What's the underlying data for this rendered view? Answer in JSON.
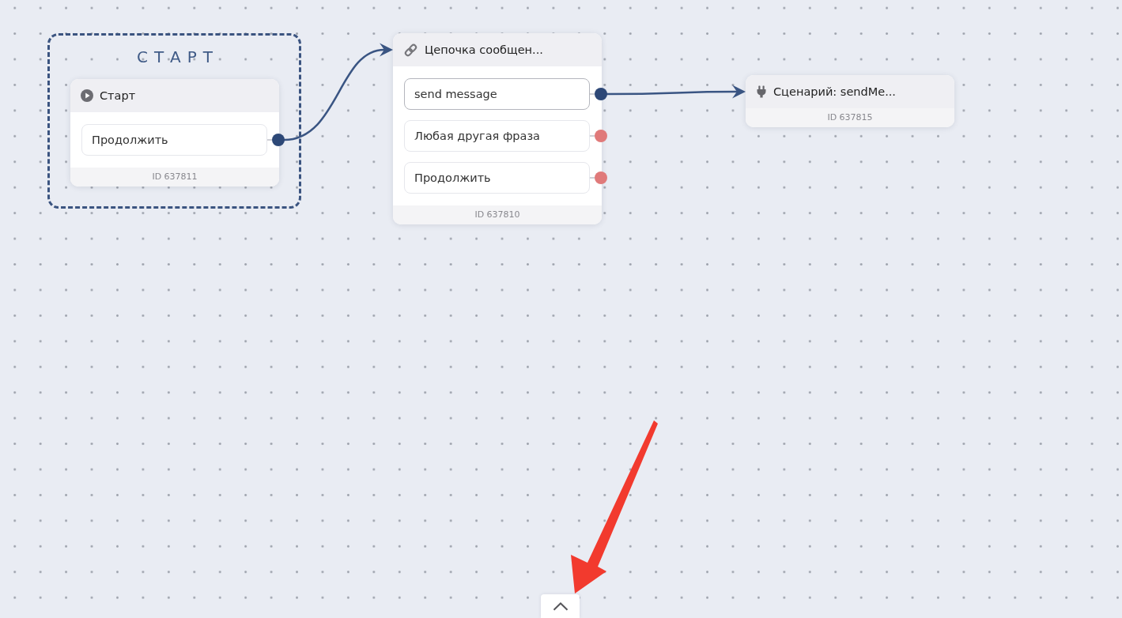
{
  "canvas": {
    "groups": [
      {
        "title": "СТАРТ",
        "nodes": [
          {
            "kind": "start",
            "title": "Старт",
            "outputs": [
              {
                "label": "Продолжить",
                "selected": false,
                "connected": true
              }
            ],
            "id_label": "ID 637811"
          }
        ]
      }
    ],
    "nodes": [
      {
        "kind": "chain",
        "title": "Цепочка сообщен...",
        "outputs": [
          {
            "label": "send message",
            "selected": true,
            "connected": true
          },
          {
            "label": "Любая другая фраза",
            "selected": false,
            "connected": false
          },
          {
            "label": "Продолжить",
            "selected": false,
            "connected": false
          }
        ],
        "id_label": "ID 637810"
      },
      {
        "kind": "scenario",
        "title": "Сценарий: sendMe...",
        "id_label": "ID 637815"
      }
    ]
  },
  "bottom_panel": {
    "expanded": false
  },
  "annotation": {
    "kind": "arrow"
  }
}
